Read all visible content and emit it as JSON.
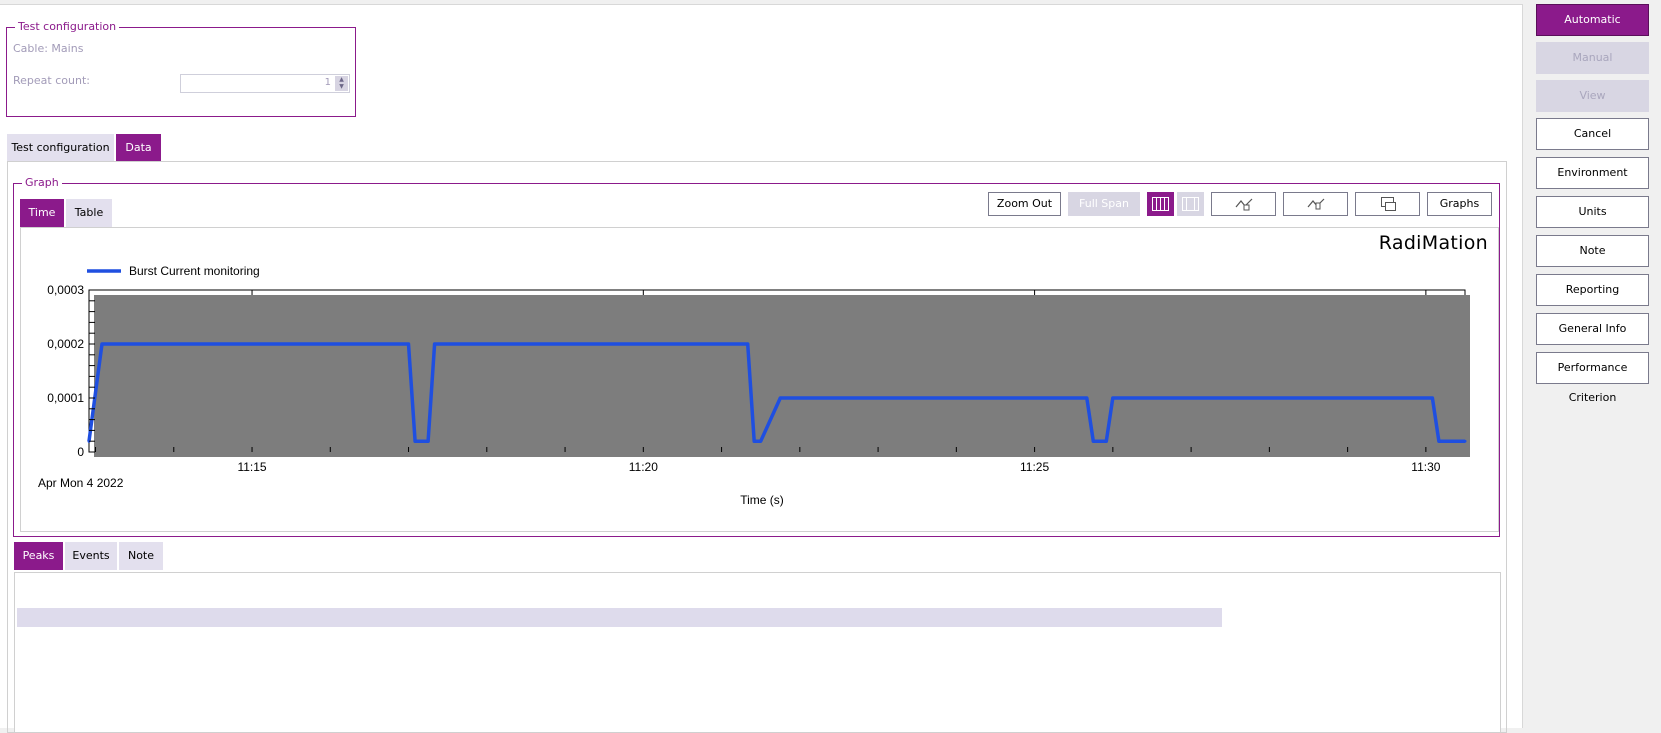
{
  "test_config": {
    "legend": "Test configuration",
    "cable_label": "Cable: Mains",
    "repeat_label": "Repeat count:",
    "repeat_value": "1"
  },
  "top_tabs": [
    {
      "label": "Test configuration",
      "active": false
    },
    {
      "label": "Data",
      "active": true
    }
  ],
  "graph": {
    "legend": "Graph",
    "tabs": [
      {
        "label": "Time",
        "active": true
      },
      {
        "label": "Table",
        "active": false
      }
    ],
    "toolbar": {
      "zoom_out": "Zoom Out",
      "full_span": "Full Span",
      "graphs": "Graphs"
    },
    "brand": "RadiMation"
  },
  "bottom_tabs": [
    {
      "label": "Peaks",
      "active": true
    },
    {
      "label": "Events",
      "active": false
    },
    {
      "label": "Note",
      "active": false
    }
  ],
  "sidebar": {
    "buttons": [
      {
        "label": "Automatic",
        "state": "active"
      },
      {
        "label": "Manual",
        "state": "disabled"
      },
      {
        "label": "View",
        "state": "disabled"
      },
      {
        "label": "Cancel",
        "state": "normal"
      },
      {
        "label": "Environment",
        "state": "normal"
      },
      {
        "label": "Units",
        "state": "normal"
      },
      {
        "label": "Note",
        "state": "normal"
      },
      {
        "label": "Reporting",
        "state": "normal"
      },
      {
        "label": "General Info",
        "state": "normal"
      },
      {
        "label": "Performance Criterion",
        "state": "normal"
      }
    ]
  },
  "colors": {
    "accent": "#8b1a8b",
    "series": "#1f4fe0"
  },
  "chart_data": {
    "type": "line",
    "xlabel": "Time (s)",
    "date_label": "Apr Mon 4 2022",
    "x_ticks": [
      "11:15",
      "11:20",
      "11:25",
      "11:30"
    ],
    "y_ticks": [
      "0",
      "0,0001",
      "0,0002",
      "0,0003"
    ],
    "xlim": [
      "11:12:55",
      "11:30:30"
    ],
    "ylim": [
      0,
      0.0003
    ],
    "grid": true,
    "legend_position": "top-left",
    "series": [
      {
        "name": "Burst Current monitoring",
        "x": [
          "11:12:55",
          "11:13:05",
          "11:17:00",
          "11:17:05",
          "11:17:15",
          "11:17:20",
          "11:17:30",
          "11:21:20",
          "11:21:25",
          "11:21:30",
          "11:21:45",
          "11:25:40",
          "11:25:45",
          "11:25:55",
          "11:26:00",
          "11:30:05",
          "11:30:10",
          "11:30:30"
        ],
        "y": [
          2e-05,
          0.0002,
          0.0002,
          2e-05,
          2e-05,
          0.0002,
          0.0002,
          0.0002,
          2e-05,
          2e-05,
          0.0001,
          0.0001,
          2e-05,
          2e-05,
          0.0001,
          0.0001,
          2e-05,
          2e-05
        ]
      }
    ]
  }
}
